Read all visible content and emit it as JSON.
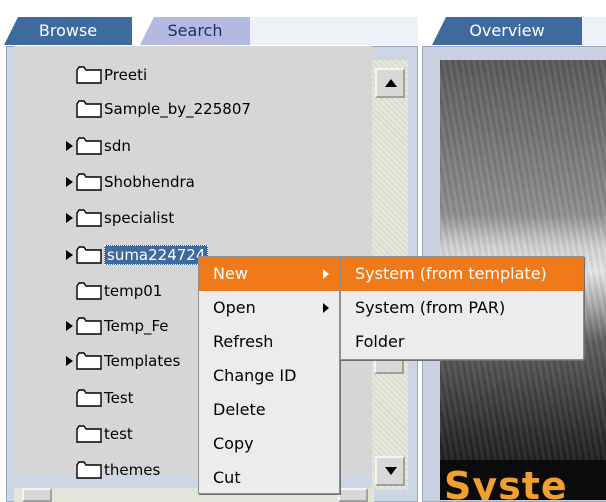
{
  "left_panel": {
    "tabs": [
      {
        "label": "Browse",
        "active": true
      },
      {
        "label": "Search",
        "active": false
      }
    ],
    "tree_items": [
      {
        "label": "Preeti",
        "expandable": false,
        "selected": false
      },
      {
        "label": "Sample_by_225807",
        "expandable": false,
        "selected": false
      },
      {
        "label": "sdn",
        "expandable": true,
        "selected": false
      },
      {
        "label": "Shobhendra",
        "expandable": true,
        "selected": false
      },
      {
        "label": "specialist",
        "expandable": true,
        "selected": false
      },
      {
        "label": "suma224724",
        "expandable": true,
        "selected": true
      },
      {
        "label": "temp01",
        "expandable": false,
        "selected": false
      },
      {
        "label": "Temp_Fe",
        "expandable": true,
        "selected": false
      },
      {
        "label": "Templates",
        "expandable": true,
        "selected": false
      },
      {
        "label": "Test",
        "expandable": false,
        "selected": false
      },
      {
        "label": "test",
        "expandable": false,
        "selected": false
      },
      {
        "label": "themes",
        "expandable": false,
        "selected": false
      }
    ]
  },
  "right_panel": {
    "tab_label": "Overview",
    "image_title": "Syste"
  },
  "context_menu": {
    "items": [
      {
        "label": "New",
        "has_submenu": true,
        "active": true
      },
      {
        "label": "Open",
        "has_submenu": true,
        "active": false
      },
      {
        "label": "Refresh",
        "has_submenu": false,
        "active": false
      },
      {
        "label": "Change ID",
        "has_submenu": false,
        "active": false
      },
      {
        "label": "Delete",
        "has_submenu": false,
        "active": false
      },
      {
        "label": "Copy",
        "has_submenu": false,
        "active": false
      },
      {
        "label": "Cut",
        "has_submenu": false,
        "active": false
      }
    ],
    "submenu_items": [
      {
        "label": "System (from template)",
        "active": true
      },
      {
        "label": "System (from PAR)",
        "active": false
      },
      {
        "label": "Folder",
        "active": false
      }
    ]
  },
  "colors": {
    "tab_blue": "#3f6aa0",
    "tab_lavender": "#b4b9e0",
    "menu_highlight": "#f07a1a",
    "image_title_orange": "#f0a030"
  },
  "icons": {
    "folder": "folder-icon",
    "expand": "expand-arrow-icon",
    "submenu": "submenu-arrow-icon",
    "scroll_up": "scroll-up-icon",
    "scroll_down": "scroll-down-icon"
  }
}
